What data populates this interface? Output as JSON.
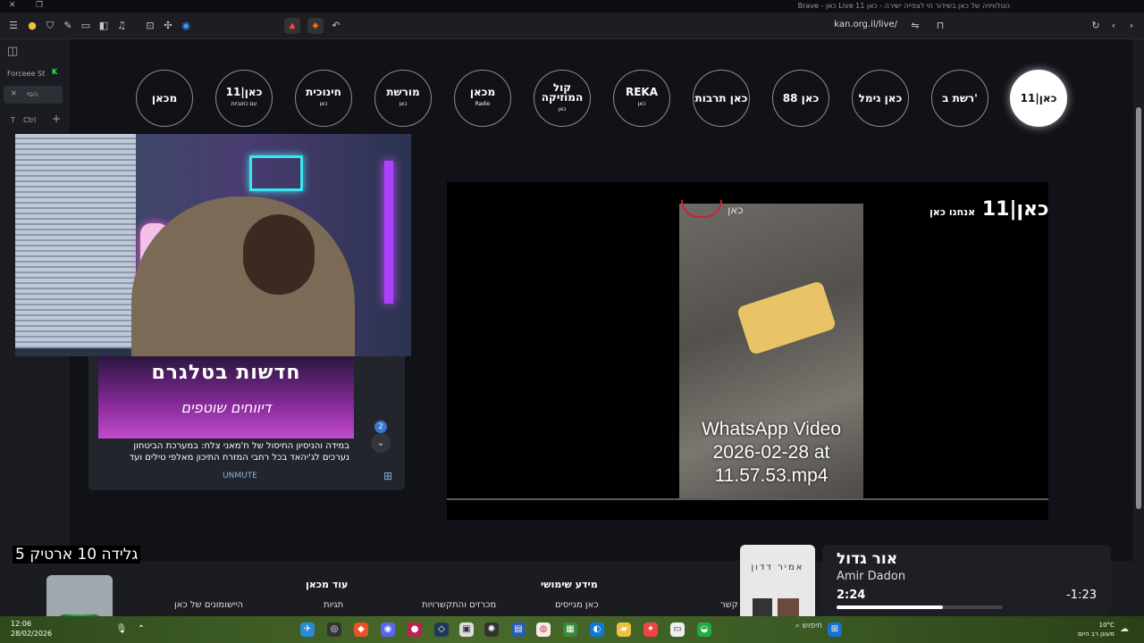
{
  "window": {
    "title": "הטלוויזיה של כאן בשידור חי לצפייה ישירה - כאן 11 Live כאן - Brave"
  },
  "browser": {
    "url": "kan.org.il/live/",
    "sidebar": {
      "profile_label": "Forceee St",
      "tab_label": "הטי",
      "ctrl_label": "Ctrl",
      "t_label": "T"
    }
  },
  "channels": [
    {
      "label": "כאן|11",
      "sub": ""
    },
    {
      "label": "רשת ב'",
      "sub": ""
    },
    {
      "label": "כאן גימל",
      "sub": ""
    },
    {
      "label": "כאן 88",
      "sub": ""
    },
    {
      "label": "כאן תרבות",
      "sub": ""
    },
    {
      "label": "REKA",
      "sub": "כאן"
    },
    {
      "label": "קול המוזיקה",
      "sub": "כאן"
    },
    {
      "label": "מכאן",
      "sub": "Radio"
    },
    {
      "label": "מורשת",
      "sub": "כאן"
    },
    {
      "label": "חינוכית",
      "sub": "כאן"
    },
    {
      "label": "כאן|11",
      "sub": "עם כתוביות"
    },
    {
      "label": "מכאן",
      "sub": ""
    }
  ],
  "player": {
    "logo": "כאן|11",
    "logo_sub": "אנחנו כאן",
    "video_caption": "WhatsApp Video 2026-02-28 at 11.57.53.mp4",
    "video_logo": "כאן"
  },
  "chat": {
    "banner_title": "חדשות בטלגרם",
    "banner_subtitle": "דיווחים שוטפים",
    "message": "במידה והניסיון החיסול של ח'מאני צלח: במערכת הביטחון נערכים לג'יהאד בכל רחבי המזרח התיכון מאלפי טילים ועד",
    "unread_count": "2",
    "unmute_label": "UNMUTE"
  },
  "footer": {
    "more_heading": "עוד מכאן",
    "more_link": "היישומונים של כאן",
    "more_link2": "תגיות",
    "info_heading": "מידע שימושי",
    "info_link1": "כאן מגייסים",
    "info_link2": "מכרזים והתקשרויות",
    "contact": "קשר"
  },
  "stream_overlay": {
    "text": "גלידה 10 ארטיק 5"
  },
  "now_playing": {
    "title": "אור גדול",
    "artist": "Amir Dadon",
    "elapsed": "2:24",
    "remaining": "-1:23",
    "progress": 0.64,
    "album_art_text": "אמיר דדון"
  },
  "taskbar": {
    "time": "12:06",
    "date": "28/02/2026",
    "search": "חיפוש",
    "weather_temp": "10°C",
    "weather_desc": "מעונן רב היום"
  }
}
